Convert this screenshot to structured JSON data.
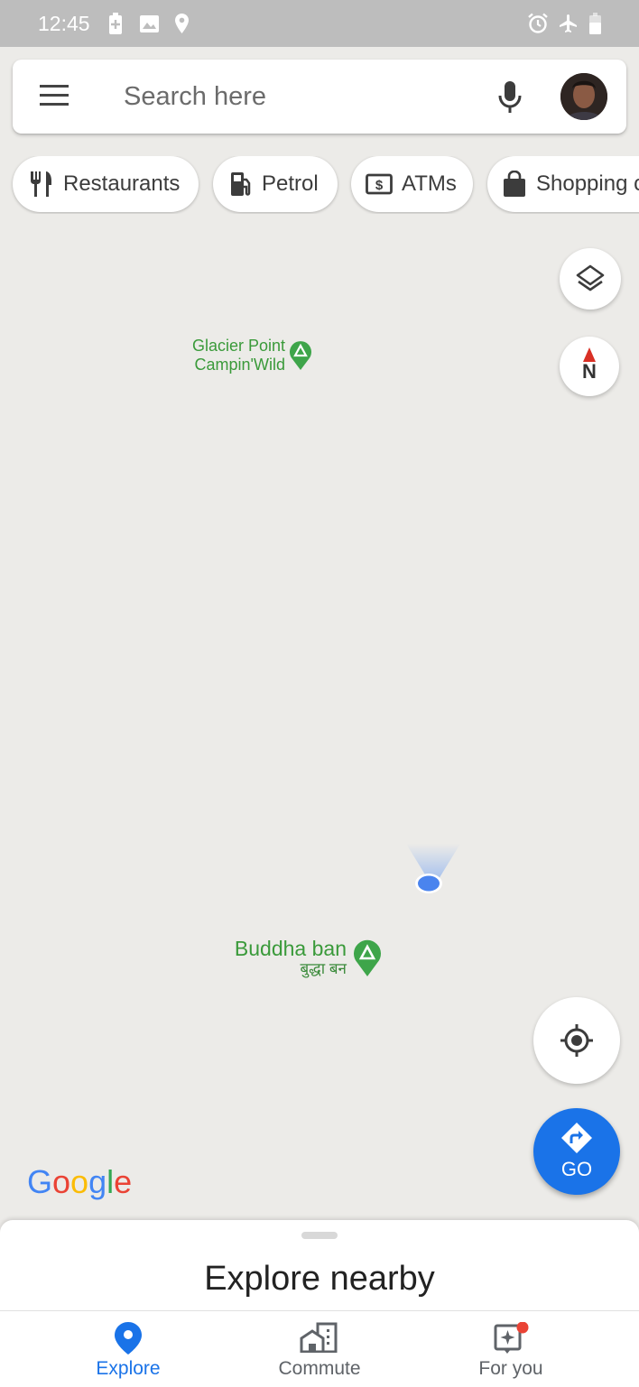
{
  "status_bar": {
    "time": "12:45",
    "left_icons": [
      "battery-saver-icon",
      "image-icon",
      "location-icon"
    ],
    "right_icons": [
      "alarm-icon",
      "airplane-icon",
      "battery-icon"
    ]
  },
  "search": {
    "placeholder": "Search here",
    "menu_icon": "menu-icon",
    "mic_icon": "mic-icon",
    "avatar": "account-avatar"
  },
  "chips": [
    {
      "label": "Restaurants",
      "icon": "restaurant-icon"
    },
    {
      "label": "Petrol",
      "icon": "fuel-icon"
    },
    {
      "label": "ATMs",
      "icon": "atm-icon"
    },
    {
      "label": "Shopping centres",
      "icon": "shopping-bag-icon"
    }
  ],
  "map": {
    "places": [
      {
        "name_line1": "Glacier Point",
        "name_line2": "Campin'Wild",
        "icon": "campground-icon"
      },
      {
        "name_line1": "Buddha ban",
        "name_line2": "बुद्धा बन",
        "icon": "campground-icon"
      }
    ],
    "compass_label": "N",
    "layers_icon": "layers-icon",
    "location_icon": "my-location-icon",
    "go_label": "GO",
    "logo_text": "Google",
    "colors": {
      "place": "#3a9a3a",
      "accent": "#1a73e8",
      "map_bg": "#ecebe8"
    }
  },
  "sheet": {
    "title": "Explore nearby"
  },
  "bottom_nav": [
    {
      "label": "Explore",
      "icon": "explore-pin-icon",
      "active": true
    },
    {
      "label": "Commute",
      "icon": "commute-icon",
      "active": false
    },
    {
      "label": "For you",
      "icon": "for-you-icon",
      "active": false,
      "badge": true
    }
  ]
}
